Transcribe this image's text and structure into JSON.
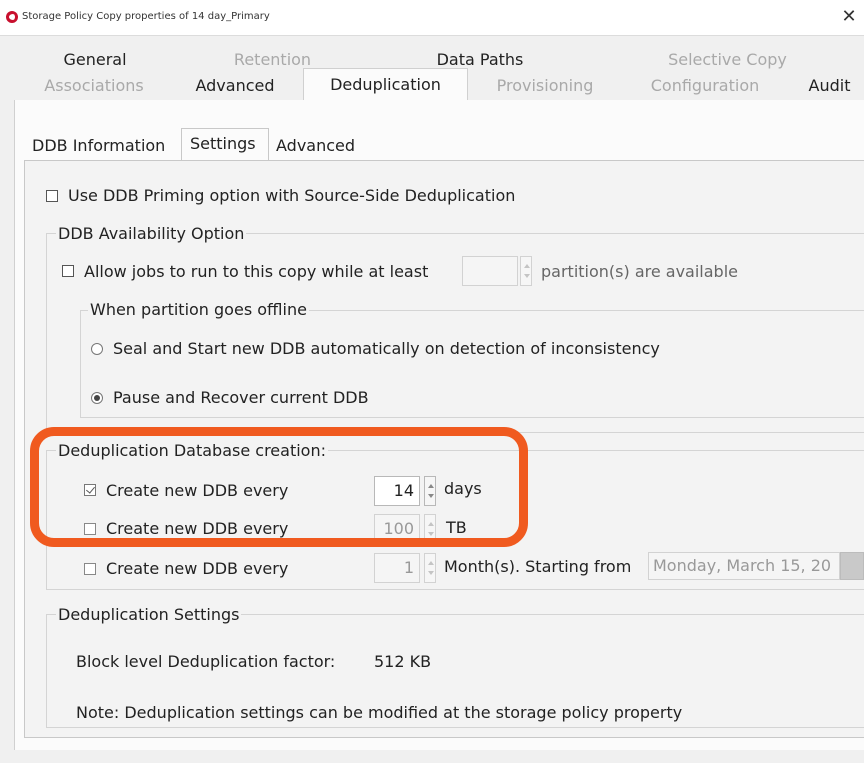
{
  "window": {
    "title": "Storage Policy Copy properties of 14 day_Primary",
    "close_glyph": "✕"
  },
  "tabs_row1": [
    {
      "label": "General",
      "enabled": true
    },
    {
      "label": "Retention",
      "enabled": false
    },
    {
      "label": "Data Paths",
      "enabled": true
    },
    {
      "label": "Selective Copy",
      "enabled": false
    }
  ],
  "tabs_row2": [
    {
      "label": "Associations",
      "enabled": false
    },
    {
      "label": "Advanced",
      "enabled": true
    },
    {
      "label": "Deduplication",
      "enabled": true,
      "active": true
    },
    {
      "label": "Provisioning",
      "enabled": false
    },
    {
      "label": "Configuration",
      "enabled": false
    },
    {
      "label": "Audit",
      "enabled": true
    }
  ],
  "subtabs": [
    {
      "label": "DDB Information"
    },
    {
      "label": "Settings",
      "active": true
    },
    {
      "label": "Advanced"
    }
  ],
  "settings": {
    "priming": {
      "label": "Use DDB Priming option with Source-Side Deduplication",
      "checked": false
    },
    "availability": {
      "legend": "DDB Availability Option",
      "allow_jobs": {
        "label_before": "Allow jobs to run to this copy while at least",
        "value": "",
        "label_after": "partition(s) are available",
        "checked": false
      },
      "offline_group": {
        "legend": "When partition goes offline",
        "options": [
          {
            "label": "Seal and Start new DDB automatically on detection of inconsistency",
            "selected": false
          },
          {
            "label": "Pause and Recover current DDB",
            "selected": true
          }
        ]
      }
    },
    "creation": {
      "legend": "Deduplication Database creation:",
      "rows": [
        {
          "label": "Create new DDB every",
          "value": "14",
          "unit": "days",
          "checked": true
        },
        {
          "label": "Create new DDB every",
          "value": "100",
          "unit": "TB",
          "checked": false
        },
        {
          "label": "Create new DDB every",
          "value": "1",
          "unit": "Month(s). Starting from",
          "checked": false,
          "date": "Monday, March 15, 20"
        }
      ]
    },
    "dedup_settings": {
      "legend": "Deduplication Settings",
      "factor_label": "Block level Deduplication factor:",
      "factor_value": "512 KB",
      "note": "Note: Deduplication settings can be modified at the storage policy property"
    }
  },
  "colors": {
    "highlight": "#f05a1f",
    "app_icon": "#c8102e"
  }
}
